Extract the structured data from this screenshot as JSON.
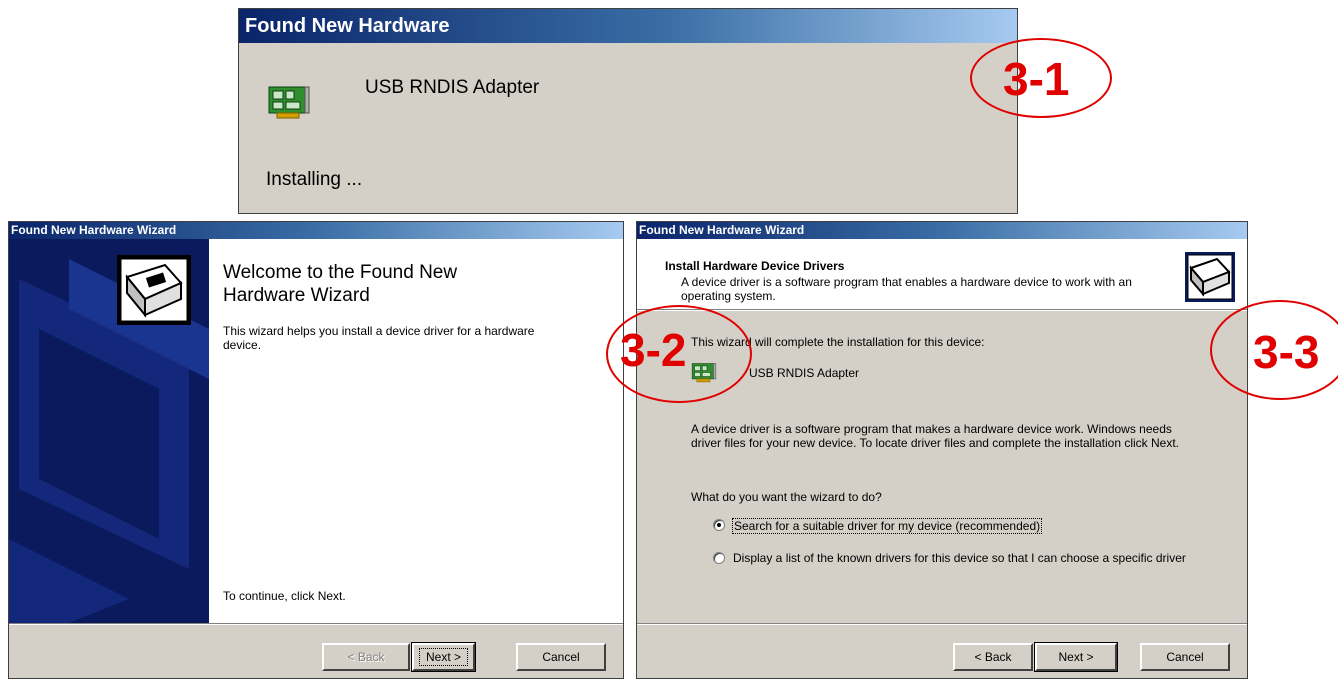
{
  "popup": {
    "title": "Found New Hardware",
    "device_name": "USB RNDIS Adapter",
    "status": "Installing ..."
  },
  "welcome_wizard": {
    "title": "Found New Hardware Wizard",
    "heading": "Welcome to the Found New Hardware Wizard",
    "body": "This wizard helps you install a device driver for a hardware device.",
    "continue_text": "To continue, click Next.",
    "buttons": {
      "back": "< Back",
      "next": "Next >",
      "cancel": "Cancel"
    }
  },
  "install_wizard": {
    "title": "Found New Hardware Wizard",
    "header_title": "Install Hardware Device Drivers",
    "header_subtitle": "A device driver is a software program that enables a hardware device to work with an operating system.",
    "intro": "This wizard will complete the installation for this device:",
    "device_name": "USB RNDIS Adapter",
    "description": "A device driver is a software program that makes a hardware device work. Windows needs driver files for your new device. To locate driver files and complete the installation click Next.",
    "question": "What do you want the wizard to do?",
    "options": [
      {
        "label": "Search for a suitable driver for my device (recommended)",
        "selected": true
      },
      {
        "label": "Display a list of the known drivers for this device so that I can choose a specific driver",
        "selected": false
      }
    ],
    "buttons": {
      "back": "< Back",
      "next": "Next >",
      "cancel": "Cancel"
    }
  },
  "annotations": {
    "step1": "3-1",
    "step2": "3-2",
    "step3": "3-3"
  },
  "colors": {
    "annotation": "#e00000",
    "titlebar_start": "#0a246a",
    "titlebar_end": "#a6caf0",
    "dialog_face": "#d4d0c8",
    "wizard_panel": "#0a1a5c"
  },
  "icons": [
    "network-card-icon",
    "hardware-wizard-icon"
  ]
}
